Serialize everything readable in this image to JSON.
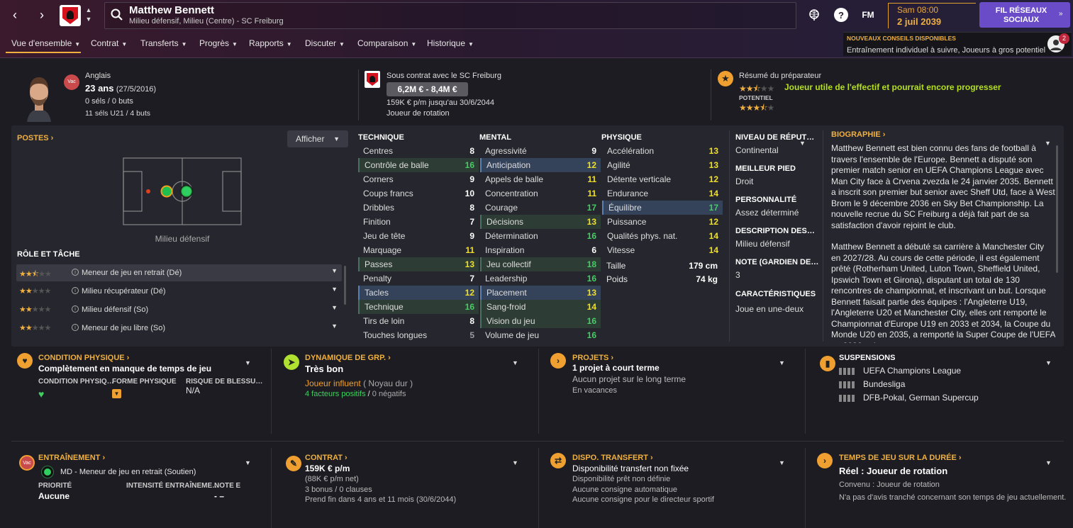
{
  "header": {
    "player_name": "Matthew Bennett",
    "player_subtitle": "Milieu défensif, Milieu (Centre) - SC Freiburg",
    "fm_label": "FM",
    "time": "Sam 08:00",
    "date": "2 juil 2039",
    "social_button": "FIL RÉSEAUX SOCIAUX",
    "advice_title": "NOUVEAUX CONSEILS DISPONIBLES",
    "advice_text": "Entraînement individuel à suivre, Joueurs à gros potentiel",
    "advice_count": "2"
  },
  "tabs": [
    "Vue d'ensemble",
    "Contrat",
    "Transferts",
    "Progrès",
    "Rapports",
    "Discuter",
    "Comparaison",
    "Historique"
  ],
  "summary": {
    "badge": "Vac",
    "nationality": "Anglais",
    "age": "23 ans",
    "dob": "(27/5/2016)",
    "caps": "0 séls / 0 buts",
    "u21": "11 séls U21 / 4 buts",
    "contract_title": "Sous contrat avec le SC Freiburg",
    "value": "6,2M € - 8,4M €",
    "wage": "159K € p/m jusqu'au 30/6/2044",
    "squad_status": "Joueur de rotation",
    "coach_title": "Résumé du préparateur",
    "coach_text": "Joueur utile de l'effectif et pourrait encore progresser",
    "potential_label": "POTENTIEL",
    "ability_stars": 2.5,
    "potential_stars": 3.5
  },
  "positions": {
    "title": "POSTES",
    "dropdown": "Afficher",
    "position_label": "Milieu défensif",
    "role_title": "RÔLE ET TÂCHE",
    "roles": [
      {
        "stars": 2.5,
        "label": "Meneur de jeu en retrait (Dé)"
      },
      {
        "stars": 2,
        "label": "Milieu récupérateur (Dé)"
      },
      {
        "stars": 2,
        "label": "Milieu défensif (So)"
      },
      {
        "stars": 2,
        "label": "Meneur de jeu libre (So)"
      }
    ]
  },
  "attributes": {
    "technique_title": "TECHNIQUE",
    "mental_title": "MENTAL",
    "physique_title": "PHYSIQUE",
    "technique": [
      {
        "name": "Centres",
        "value": "8",
        "hl": "",
        "c": "c-w"
      },
      {
        "name": "Contrôle de balle",
        "value": "16",
        "hl": "hl-green",
        "c": "c-g"
      },
      {
        "name": "Corners",
        "value": "9",
        "hl": "",
        "c": "c-w"
      },
      {
        "name": "Coups francs",
        "value": "10",
        "hl": "",
        "c": "c-w"
      },
      {
        "name": "Dribbles",
        "value": "8",
        "hl": "",
        "c": "c-w"
      },
      {
        "name": "Finition",
        "value": "7",
        "hl": "",
        "c": "c-w"
      },
      {
        "name": "Jeu de tête",
        "value": "9",
        "hl": "",
        "c": "c-w"
      },
      {
        "name": "Marquage",
        "value": "11",
        "hl": "",
        "c": "c-y"
      },
      {
        "name": "Passes",
        "value": "13",
        "hl": "hl-green",
        "c": "c-y"
      },
      {
        "name": "Penalty",
        "value": "7",
        "hl": "",
        "c": "c-w"
      },
      {
        "name": "Tacles",
        "value": "12",
        "hl": "hl-blue",
        "c": "c-y"
      },
      {
        "name": "Technique",
        "value": "16",
        "hl": "hl-green",
        "c": "c-g"
      },
      {
        "name": "Tirs de loin",
        "value": "8",
        "hl": "",
        "c": "c-w"
      },
      {
        "name": "Touches longues",
        "value": "5",
        "hl": "",
        "c": "c-gr"
      }
    ],
    "mental": [
      {
        "name": "Agressivité",
        "value": "9",
        "hl": "",
        "c": "c-w"
      },
      {
        "name": "Anticipation",
        "value": "12",
        "hl": "hl-blue",
        "c": "c-y"
      },
      {
        "name": "Appels de balle",
        "value": "11",
        "hl": "",
        "c": "c-y"
      },
      {
        "name": "Concentration",
        "value": "11",
        "hl": "",
        "c": "c-y"
      },
      {
        "name": "Courage",
        "value": "17",
        "hl": "",
        "c": "c-g"
      },
      {
        "name": "Décisions",
        "value": "13",
        "hl": "hl-green",
        "c": "c-y"
      },
      {
        "name": "Détermination",
        "value": "16",
        "hl": "",
        "c": "c-g"
      },
      {
        "name": "Inspiration",
        "value": "6",
        "hl": "",
        "c": "c-w"
      },
      {
        "name": "Jeu collectif",
        "value": "18",
        "hl": "hl-green",
        "c": "c-g"
      },
      {
        "name": "Leadership",
        "value": "16",
        "hl": "",
        "c": "c-g"
      },
      {
        "name": "Placement",
        "value": "13",
        "hl": "hl-blue",
        "c": "c-y"
      },
      {
        "name": "Sang-froid",
        "value": "14",
        "hl": "hl-green",
        "c": "c-y"
      },
      {
        "name": "Vision du jeu",
        "value": "16",
        "hl": "hl-green",
        "c": "c-g"
      },
      {
        "name": "Volume de jeu",
        "value": "16",
        "hl": "",
        "c": "c-g"
      }
    ],
    "physique": [
      {
        "name": "Accélération",
        "value": "13",
        "hl": "",
        "c": "c-y"
      },
      {
        "name": "Agilité",
        "value": "13",
        "hl": "",
        "c": "c-y"
      },
      {
        "name": "Détente verticale",
        "value": "12",
        "hl": "",
        "c": "c-y"
      },
      {
        "name": "Endurance",
        "value": "14",
        "hl": "",
        "c": "c-y"
      },
      {
        "name": "Équilibre",
        "value": "17",
        "hl": "hl-blue",
        "c": "c-g"
      },
      {
        "name": "Puissance",
        "value": "12",
        "hl": "",
        "c": "c-y"
      },
      {
        "name": "Qualités phys. nat.",
        "value": "14",
        "hl": "",
        "c": "c-y"
      },
      {
        "name": "Vitesse",
        "value": "14",
        "hl": "",
        "c": "c-y"
      }
    ],
    "height_label": "Taille",
    "height": "179 cm",
    "weight_label": "Poids",
    "weight": "74 kg"
  },
  "side": {
    "rep_title": "NIVEAU DE RÉPUT…",
    "rep_value": "Continental",
    "foot_title": "MEILLEUR PIED",
    "foot_value": "Droit",
    "pers_title": "PERSONNALITÉ",
    "pers_value": "Assez déterminé",
    "desc_title": "DESCRIPTION DES…",
    "desc_value": "Milieu défensif",
    "note_title": "NOTE (GARDIEN DE…",
    "note_value": "3",
    "car_title": "CARACTÉRISTIQUES",
    "car_value": "Joue en une-deux"
  },
  "bio": {
    "title": "BIOGRAPHIE",
    "p1": "Matthew Bennett est bien connu des fans de football à travers l'ensemble de l'Europe. Bennett a disputé son premier match senior en UEFA Champions League avec Man City face à Crvena zvezda le 24 janvier 2035. Bennett a inscrit son premier but senior avec Sheff Utd, face à West Brom le 9 décembre 2036 en Sky Bet Championship. La nouvelle recrue du SC Freiburg a déjà fait part de sa satisfaction d'avoir rejoint le club.",
    "p2": "Matthew Bennett a débuté sa carrière à Manchester City en 2027/28. Au cours de cette période, il est également prêté (Rotherham United, Luton Town, Sheffield United, Ipswich Town et Girona), disputant un total de 130 rencontres de championnat, et inscrivant un but. Lorsque Bennett faisait partie des équipes : l'Angleterre U19, l'Angleterre U20 et Manchester City, elles ont remporté le Championnat d'Europe U19 en 2033 et 2034, la Coupe du Monde U20 en 2035, a remporté la Super Coupe de l'UEFA en 2036 et la"
  },
  "cards": {
    "condition": {
      "title": "CONDITION PHYSIQUE",
      "main": "Complètement en manque de temps de jeu",
      "l1": "CONDITION PHYSIQ…",
      "l2": "FORME PHYSIQUE",
      "l3": "RISQUE DE BLESSU…",
      "v3": "N/A"
    },
    "dynamics": {
      "title": "DYNAMIQUE DE GRP.",
      "main": "Très bon",
      "influence": "Joueur influent",
      "core": "( Noyau dur )",
      "pos": "4 facteurs positifs",
      "slash": "/",
      "neg": "0 négatifs"
    },
    "projects": {
      "title": "PROJETS",
      "main": "1 projet à court terme",
      "l1": "Aucun projet sur le long terme",
      "l2": "En vacances"
    },
    "suspensions": {
      "title": "SUSPENSIONS",
      "items": [
        "UEFA Champions League",
        "Bundesliga",
        "DFB-Pokal, German Supercup"
      ]
    },
    "training": {
      "title": "ENTRAÎNEMENT",
      "badge": "Vac",
      "role": "MD - Meneur de jeu en retrait (Soutien)",
      "l1": "PRIORITÉ",
      "v1": "Aucune",
      "l2": "INTENSITÉ ENTRAÎNEME…",
      "l3": "NOTE E",
      "v3": "- –"
    },
    "contract": {
      "title": "CONTRAT",
      "main": "159K € p/m",
      "l1": "(88K € p/m net)",
      "l2": "3 bonus / 0 clauses",
      "l3": "Prend fin dans 4 ans et 11 mois  (30/6/2044)"
    },
    "transfer": {
      "title": "DISPO. TRANSFERT",
      "main": "Disponibilité transfert non fixée",
      "l1": "Disponibilité prêt non définie",
      "l2": "Aucune consigne automatique",
      "l3": "Aucune consigne pour le directeur sportif"
    },
    "playtime": {
      "title": "TEMPS DE JEU SUR LA DURÉE",
      "main": "Réel : Joueur de rotation",
      "l1": "Convenu :  Joueur de rotation",
      "l2": "N'a pas d'avis tranché concernant son temps de jeu actuellement."
    }
  }
}
